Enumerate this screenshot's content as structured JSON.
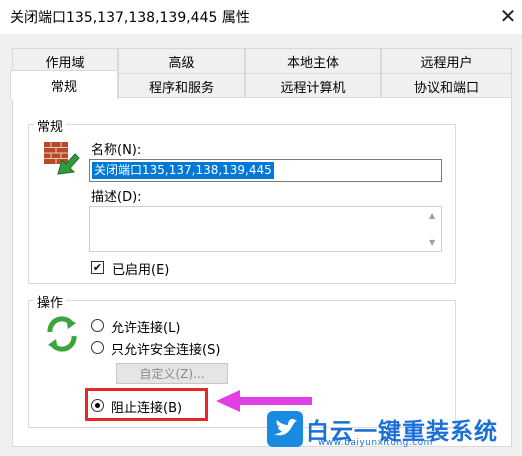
{
  "window": {
    "title": "关闭端口135,137,138,139,445 属性",
    "close_glyph": "✕"
  },
  "tabs": {
    "row1": [
      "作用域",
      "高级",
      "本地主体",
      "远程用户"
    ],
    "row2": [
      "常规",
      "程序和服务",
      "远程计算机",
      "协议和端口"
    ],
    "active": "常规"
  },
  "general_group": {
    "label": "常规",
    "name_label": "名称(N):",
    "name_value": "关闭端口135,137,138,139,445",
    "desc_label": "描述(D):",
    "desc_value": "",
    "enabled_label": "已启用(E)",
    "enabled_checked": true
  },
  "action_group": {
    "label": "操作",
    "options": [
      {
        "label": "允许连接(L)",
        "selected": false
      },
      {
        "label": "只允许安全连接(S)",
        "selected": false
      },
      {
        "label": "阻止连接(B)",
        "selected": true
      }
    ],
    "custom_button": "自定义(Z)..."
  },
  "annotation": {
    "arrow_color": "#e23ee6",
    "highlight_color": "#e8272c"
  },
  "watermark": {
    "brand": "白云一键重装系统",
    "url": "www.baiyunxitong.com",
    "color": "#1a6fd8"
  },
  "icons": [
    "firewall-rule-icon",
    "refresh-arrows-icon",
    "bird-logo-icon",
    "close-icon",
    "scroll-up-icon",
    "scroll-down-icon"
  ]
}
